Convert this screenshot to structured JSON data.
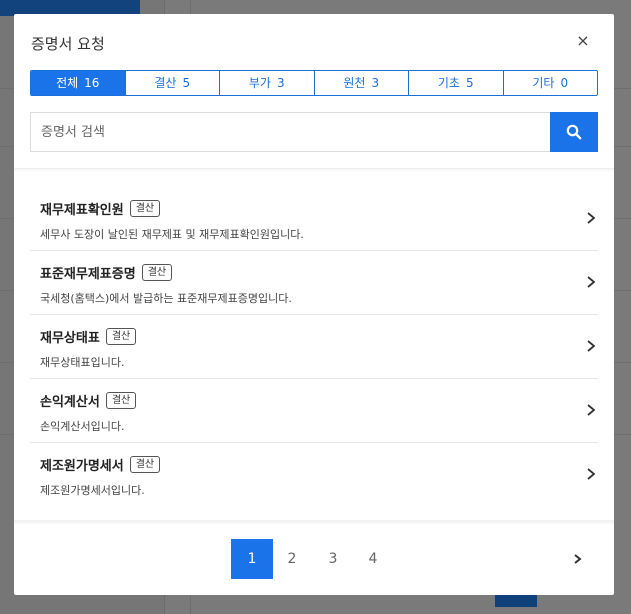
{
  "modal": {
    "title": "증명서 요청",
    "close_symbol": "×"
  },
  "tabs": [
    {
      "label": "전체",
      "count": "16",
      "active": true
    },
    {
      "label": "결산",
      "count": "5"
    },
    {
      "label": "부가",
      "count": "3"
    },
    {
      "label": "원천",
      "count": "3"
    },
    {
      "label": "기초",
      "count": "5"
    },
    {
      "label": "기타",
      "count": "0"
    }
  ],
  "search": {
    "placeholder": "증명서 검색",
    "button_icon": "search-icon"
  },
  "items": [
    {
      "title": "재무제표확인원",
      "badge": "결산",
      "desc": "세무사 도장이 날인된 재무제표 및 재무제표확인원입니다."
    },
    {
      "title": "표준재무제표증명",
      "badge": "결산",
      "desc": "국세청(홈택스)에서 발급하는 표준재무제표증명입니다."
    },
    {
      "title": "재무상태표",
      "badge": "결산",
      "desc": "재무상태표입니다."
    },
    {
      "title": "손익계산서",
      "badge": "결산",
      "desc": "손익계산서입니다."
    },
    {
      "title": "제조원가명세서",
      "badge": "결산",
      "desc": "제조원가명세서입니다."
    }
  ],
  "pagination": {
    "pages": [
      "1",
      "2",
      "3",
      "4"
    ],
    "current": "1",
    "next_icon": "chevron-right-icon"
  },
  "colors": {
    "accent": "#1a73e8",
    "overlay": "#7a7a7a"
  }
}
